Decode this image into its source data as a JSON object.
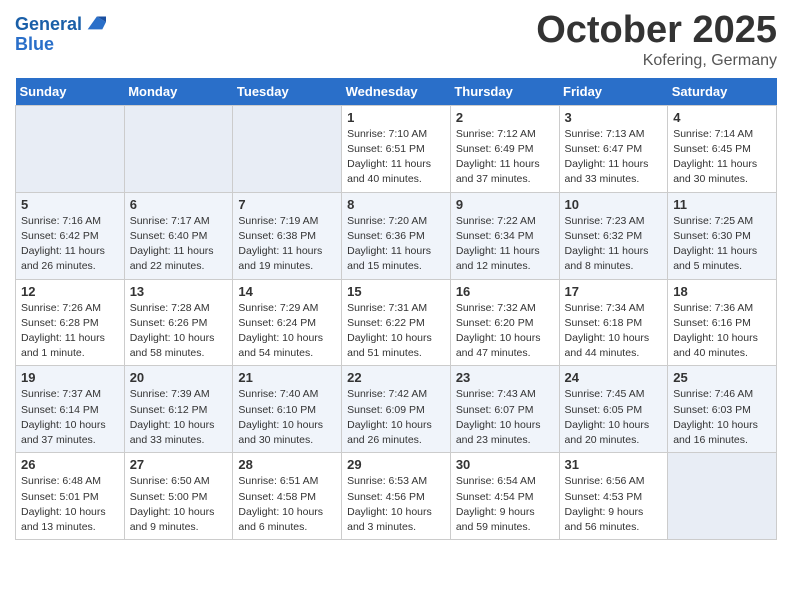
{
  "header": {
    "logo_line1": "General",
    "logo_line2": "Blue",
    "month": "October 2025",
    "location": "Kofering, Germany"
  },
  "weekdays": [
    "Sunday",
    "Monday",
    "Tuesday",
    "Wednesday",
    "Thursday",
    "Friday",
    "Saturday"
  ],
  "weeks": [
    [
      {
        "day": "",
        "info": ""
      },
      {
        "day": "",
        "info": ""
      },
      {
        "day": "",
        "info": ""
      },
      {
        "day": "1",
        "info": "Sunrise: 7:10 AM\nSunset: 6:51 PM\nDaylight: 11 hours\nand 40 minutes."
      },
      {
        "day": "2",
        "info": "Sunrise: 7:12 AM\nSunset: 6:49 PM\nDaylight: 11 hours\nand 37 minutes."
      },
      {
        "day": "3",
        "info": "Sunrise: 7:13 AM\nSunset: 6:47 PM\nDaylight: 11 hours\nand 33 minutes."
      },
      {
        "day": "4",
        "info": "Sunrise: 7:14 AM\nSunset: 6:45 PM\nDaylight: 11 hours\nand 30 minutes."
      }
    ],
    [
      {
        "day": "5",
        "info": "Sunrise: 7:16 AM\nSunset: 6:42 PM\nDaylight: 11 hours\nand 26 minutes."
      },
      {
        "day": "6",
        "info": "Sunrise: 7:17 AM\nSunset: 6:40 PM\nDaylight: 11 hours\nand 22 minutes."
      },
      {
        "day": "7",
        "info": "Sunrise: 7:19 AM\nSunset: 6:38 PM\nDaylight: 11 hours\nand 19 minutes."
      },
      {
        "day": "8",
        "info": "Sunrise: 7:20 AM\nSunset: 6:36 PM\nDaylight: 11 hours\nand 15 minutes."
      },
      {
        "day": "9",
        "info": "Sunrise: 7:22 AM\nSunset: 6:34 PM\nDaylight: 11 hours\nand 12 minutes."
      },
      {
        "day": "10",
        "info": "Sunrise: 7:23 AM\nSunset: 6:32 PM\nDaylight: 11 hours\nand 8 minutes."
      },
      {
        "day": "11",
        "info": "Sunrise: 7:25 AM\nSunset: 6:30 PM\nDaylight: 11 hours\nand 5 minutes."
      }
    ],
    [
      {
        "day": "12",
        "info": "Sunrise: 7:26 AM\nSunset: 6:28 PM\nDaylight: 11 hours\nand 1 minute."
      },
      {
        "day": "13",
        "info": "Sunrise: 7:28 AM\nSunset: 6:26 PM\nDaylight: 10 hours\nand 58 minutes."
      },
      {
        "day": "14",
        "info": "Sunrise: 7:29 AM\nSunset: 6:24 PM\nDaylight: 10 hours\nand 54 minutes."
      },
      {
        "day": "15",
        "info": "Sunrise: 7:31 AM\nSunset: 6:22 PM\nDaylight: 10 hours\nand 51 minutes."
      },
      {
        "day": "16",
        "info": "Sunrise: 7:32 AM\nSunset: 6:20 PM\nDaylight: 10 hours\nand 47 minutes."
      },
      {
        "day": "17",
        "info": "Sunrise: 7:34 AM\nSunset: 6:18 PM\nDaylight: 10 hours\nand 44 minutes."
      },
      {
        "day": "18",
        "info": "Sunrise: 7:36 AM\nSunset: 6:16 PM\nDaylight: 10 hours\nand 40 minutes."
      }
    ],
    [
      {
        "day": "19",
        "info": "Sunrise: 7:37 AM\nSunset: 6:14 PM\nDaylight: 10 hours\nand 37 minutes."
      },
      {
        "day": "20",
        "info": "Sunrise: 7:39 AM\nSunset: 6:12 PM\nDaylight: 10 hours\nand 33 minutes."
      },
      {
        "day": "21",
        "info": "Sunrise: 7:40 AM\nSunset: 6:10 PM\nDaylight: 10 hours\nand 30 minutes."
      },
      {
        "day": "22",
        "info": "Sunrise: 7:42 AM\nSunset: 6:09 PM\nDaylight: 10 hours\nand 26 minutes."
      },
      {
        "day": "23",
        "info": "Sunrise: 7:43 AM\nSunset: 6:07 PM\nDaylight: 10 hours\nand 23 minutes."
      },
      {
        "day": "24",
        "info": "Sunrise: 7:45 AM\nSunset: 6:05 PM\nDaylight: 10 hours\nand 20 minutes."
      },
      {
        "day": "25",
        "info": "Sunrise: 7:46 AM\nSunset: 6:03 PM\nDaylight: 10 hours\nand 16 minutes."
      }
    ],
    [
      {
        "day": "26",
        "info": "Sunrise: 6:48 AM\nSunset: 5:01 PM\nDaylight: 10 hours\nand 13 minutes."
      },
      {
        "day": "27",
        "info": "Sunrise: 6:50 AM\nSunset: 5:00 PM\nDaylight: 10 hours\nand 9 minutes."
      },
      {
        "day": "28",
        "info": "Sunrise: 6:51 AM\nSunset: 4:58 PM\nDaylight: 10 hours\nand 6 minutes."
      },
      {
        "day": "29",
        "info": "Sunrise: 6:53 AM\nSunset: 4:56 PM\nDaylight: 10 hours\nand 3 minutes."
      },
      {
        "day": "30",
        "info": "Sunrise: 6:54 AM\nSunset: 4:54 PM\nDaylight: 9 hours\nand 59 minutes."
      },
      {
        "day": "31",
        "info": "Sunrise: 6:56 AM\nSunset: 4:53 PM\nDaylight: 9 hours\nand 56 minutes."
      },
      {
        "day": "",
        "info": ""
      }
    ]
  ]
}
